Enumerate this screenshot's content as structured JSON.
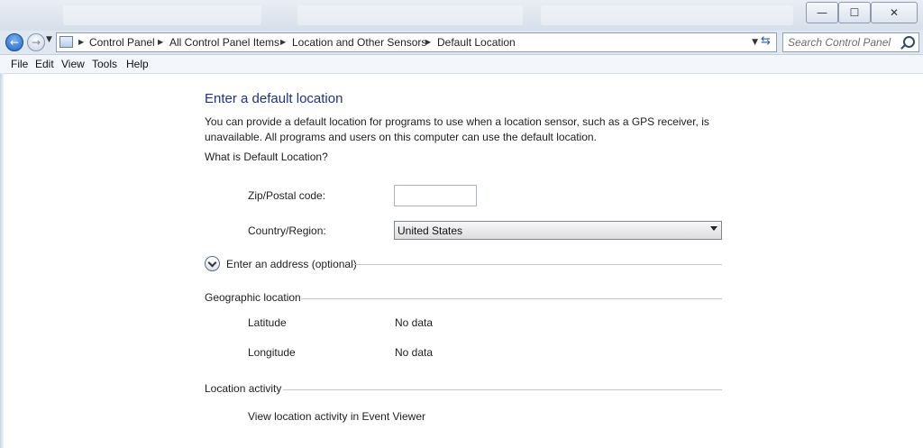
{
  "window": {
    "minimize_glyph": "—",
    "maximize_glyph": "☐",
    "close_glyph": "✕"
  },
  "address_bar": {
    "crumbs": [
      "Control Panel",
      "All Control Panel Items",
      "Location and Other Sensors",
      "Default Location"
    ],
    "separator": "▶",
    "search_placeholder": "Search Control Panel"
  },
  "menu": [
    "File",
    "Edit",
    "View",
    "Tools",
    "Help"
  ],
  "page": {
    "title": "Enter a default location",
    "description": "You can provide a default location for programs to use when a location sensor, such as a GPS receiver, is unavailable. All programs and users on this computer can use the default location.",
    "help_link": "What is Default Location?",
    "zip_label": "Zip/Postal code:",
    "zip_value": "",
    "country_label": "Country/Region:",
    "country_value": "United States",
    "address_toggle": "Enter an address (optional)",
    "geo_section": "Geographic location",
    "latitude_label": "Latitude",
    "latitude_value": "No data",
    "longitude_label": "Longitude",
    "longitude_value": "No data",
    "activity_section": "Location activity",
    "activity_link": "View location activity in Event Viewer"
  }
}
